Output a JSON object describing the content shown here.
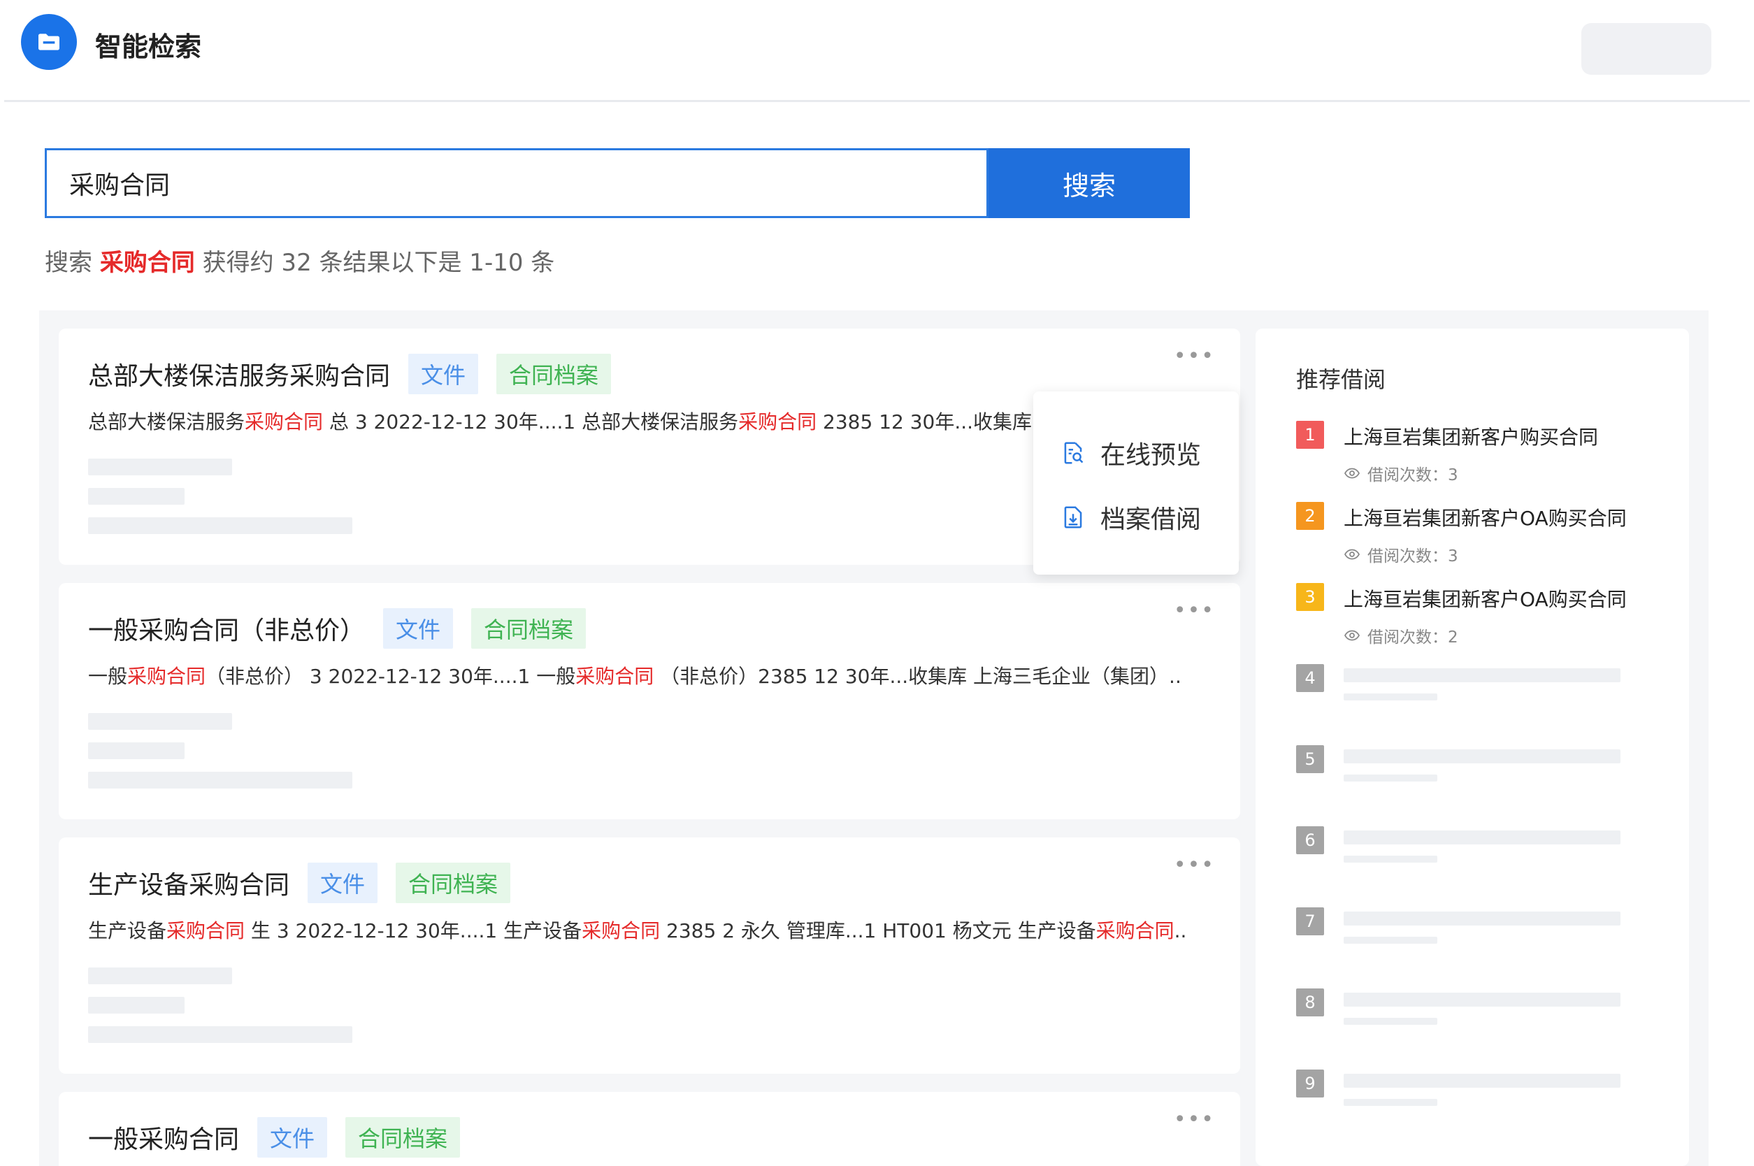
{
  "header": {
    "app_title": "智能检索",
    "logo_icon": "folder-icon",
    "brand_color": "#1a73e8"
  },
  "search": {
    "query": "采购合同",
    "button_label": "搜索"
  },
  "summary": {
    "prefix": "搜索",
    "keyword": "采购合同",
    "suffix": "获得约 32 条结果以下是 1-10 条"
  },
  "results": [
    {
      "title": "总部大楼保洁服务采购合同",
      "tag_file": "文件",
      "tag_archive": "合同档案",
      "more": "•••",
      "snippet": [
        {
          "t": "总部大楼保洁服务",
          "hl": false
        },
        {
          "t": "采购合同",
          "hl": true
        },
        {
          "t": " 总 3 2022-12-12 30年....1 总部大楼保洁服务",
          "hl": false
        },
        {
          "t": "采购合同",
          "hl": true
        },
        {
          "t": " 2385 12 30年...收集库 南",
          "hl": false
        }
      ]
    },
    {
      "title": "一般采购合同（非总价）",
      "tag_file": "文件",
      "tag_archive": "合同档案",
      "more": "•••",
      "snippet": [
        {
          "t": "一般",
          "hl": false
        },
        {
          "t": "采购合同",
          "hl": true
        },
        {
          "t": "（非总价） 3 2022-12-12 30年....1 一般",
          "hl": false
        },
        {
          "t": "采购合同",
          "hl": true
        },
        {
          "t": " （非总价）2385 12 30年...收集库 上海三毛企业（集团）..",
          "hl": false
        }
      ]
    },
    {
      "title": "生产设备采购合同",
      "tag_file": "文件",
      "tag_archive": "合同档案",
      "more": "•••",
      "snippet": [
        {
          "t": "生产设备",
          "hl": false
        },
        {
          "t": "采购合同",
          "hl": true
        },
        {
          "t": " 生 3 2022-12-12 30年....1 生产设备",
          "hl": false
        },
        {
          "t": "采购合同",
          "hl": true
        },
        {
          "t": " 2385 2 永久 管理库...1 HT001 杨文元 生产设备",
          "hl": false
        },
        {
          "t": "采购合同",
          "hl": true
        },
        {
          "t": "..",
          "hl": false
        }
      ]
    },
    {
      "title": "一般采购合同",
      "tag_file": "文件",
      "tag_archive": "合同档案",
      "more": "•••",
      "snippet": []
    }
  ],
  "dropdown": {
    "preview_label": "在线预览",
    "preview_icon": "document-search-icon",
    "borrow_label": "档案借阅",
    "borrow_icon": "document-download-icon"
  },
  "side_panel": {
    "title": "推荐借阅",
    "items": [
      {
        "rank": "1",
        "title": "上海亘岩集团新客户购买合同",
        "meta": "借阅次数：3",
        "badge_color": "#f15b5b"
      },
      {
        "rank": "2",
        "title": "上海亘岩集团新客户OA购买合同",
        "meta": "借阅次数：3",
        "badge_color": "#f5961f"
      },
      {
        "rank": "3",
        "title": "上海亘岩集团新客户OA购买合同",
        "meta": "借阅次数：2",
        "badge_color": "#f7b61a"
      },
      {
        "rank": "4",
        "badge_color": "#a4a4a4"
      },
      {
        "rank": "5",
        "badge_color": "#a4a4a4"
      },
      {
        "rank": "6",
        "badge_color": "#a4a4a4"
      },
      {
        "rank": "7",
        "badge_color": "#a4a4a4"
      },
      {
        "rank": "8",
        "badge_color": "#a4a4a4"
      },
      {
        "rank": "9",
        "badge_color": "#a4a4a4"
      }
    ]
  }
}
